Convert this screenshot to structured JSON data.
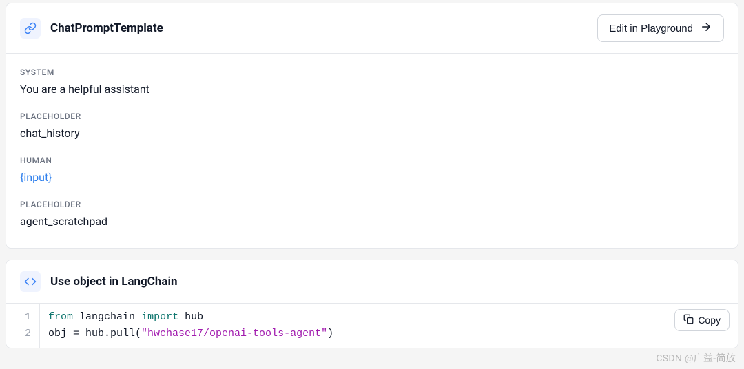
{
  "header": {
    "title": "ChatPromptTemplate",
    "edit_label": "Edit in Playground"
  },
  "messages": [
    {
      "label": "SYSTEM",
      "content": "You are a helpful assistant",
      "template": false
    },
    {
      "label": "PLACEHOLDER",
      "content": "chat_history",
      "template": false
    },
    {
      "label": "HUMAN",
      "content": "{input}",
      "template": true
    },
    {
      "label": "PLACEHOLDER",
      "content": "agent_scratchpad",
      "template": false
    }
  ],
  "code_section": {
    "title": "Use object in LangChain",
    "copy_label": "Copy",
    "lines": [
      {
        "n": "1",
        "kw1": "from",
        "id1": "langchain",
        "kw2": "import",
        "id2": "hub"
      },
      {
        "n": "2",
        "prefix": "obj = hub.pull(",
        "str": "\"hwchase17/openai-tools-agent\"",
        "suffix": ")"
      }
    ]
  },
  "watermark": "CSDN @广益-简放"
}
